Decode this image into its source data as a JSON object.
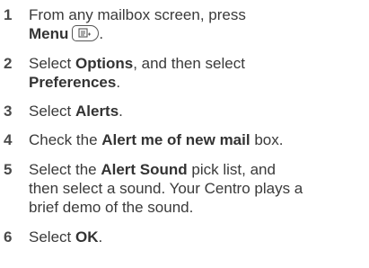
{
  "steps": [
    {
      "number": "1",
      "parts": [
        "From any mailbox screen, press",
        "Menu",
        "."
      ],
      "icon": "menu-key-icon"
    },
    {
      "number": "2",
      "parts": [
        "Select ",
        "Options",
        ", and then select",
        "Preferences",
        "."
      ]
    },
    {
      "number": "3",
      "parts": [
        "Select ",
        "Alerts",
        "."
      ]
    },
    {
      "number": "4",
      "parts": [
        "Check the ",
        "Alert me of new mail",
        " box."
      ]
    },
    {
      "number": "5",
      "parts": [
        "Select the ",
        "Alert Sound",
        " pick list, and",
        "then select a sound. Your Centro plays a",
        "brief demo of the sound."
      ]
    },
    {
      "number": "6",
      "parts": [
        "Select ",
        "OK",
        "."
      ]
    }
  ]
}
